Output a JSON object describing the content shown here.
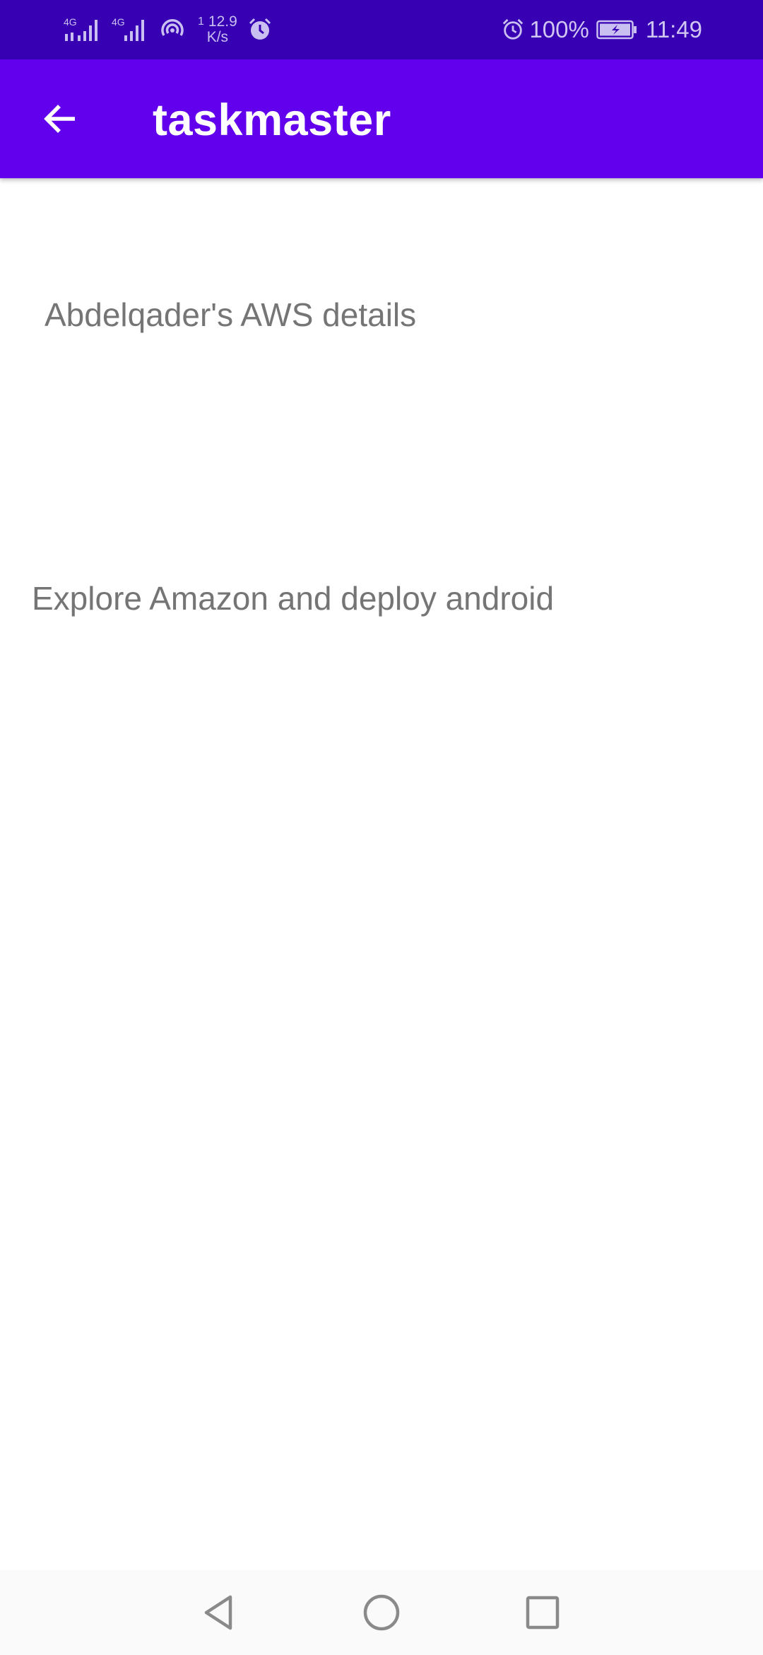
{
  "status_bar": {
    "signal_1_label": "4G",
    "signal_2_label": "4G",
    "net_speed_value": "12.9",
    "net_speed_unit": "K/s",
    "net_speed_sup": "1",
    "battery_percent": "100%",
    "time": "11:49",
    "icons": [
      "signal-icon",
      "signal-icon",
      "hotspot-icon",
      "alarm-icon",
      "alarm-icon",
      "battery-charging-icon"
    ]
  },
  "app_bar": {
    "title": "taskmaster",
    "back_icon": "arrow-left-icon",
    "color": "#6200ee"
  },
  "task": {
    "title": "Abdelqader's AWS details",
    "body": "Explore Amazon and deploy android"
  },
  "nav_bar": {
    "icons": [
      "nav-back-icon",
      "nav-home-icon",
      "nav-recent-icon"
    ]
  },
  "colors": {
    "status_bar": "#3700b3",
    "app_bar": "#6200ee",
    "text_secondary": "#757575"
  }
}
